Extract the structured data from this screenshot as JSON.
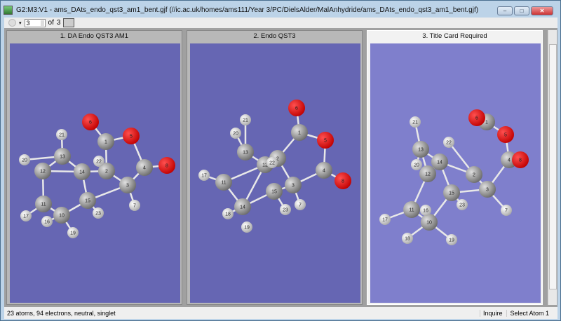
{
  "window": {
    "title": "G2:M3:V1 - ams_DAts_endo_qst3_am1_bent.gjf (//ic.ac.uk/homes/ams111/Year 3/PC/DielsAlder/MalAnhydride/ams_DAts_endo_qst3_am1_bent.gjf)",
    "minimize": "–",
    "maximize": "□",
    "close": "✕"
  },
  "toolbar": {
    "frame_value": "3",
    "of_label": "of",
    "total": "3"
  },
  "panels": [
    {
      "title": "1.  DA Endo QST3 AM1",
      "bg": "#6666b3",
      "atoms": [
        {
          "label": "1",
          "el": "C"
        },
        {
          "label": "2",
          "el": "C"
        },
        {
          "label": "3",
          "el": "C"
        },
        {
          "label": "4",
          "el": "C"
        },
        {
          "label": "5",
          "el": "O"
        },
        {
          "label": "6",
          "el": "O"
        },
        {
          "label": "7",
          "el": "H"
        },
        {
          "label": "8",
          "el": "O"
        },
        {
          "label": "10",
          "el": "C"
        },
        {
          "label": "11",
          "el": "C"
        },
        {
          "label": "12",
          "el": "C"
        },
        {
          "label": "13",
          "el": "C"
        },
        {
          "label": "14",
          "el": "C"
        },
        {
          "label": "15",
          "el": "C"
        },
        {
          "label": "16",
          "el": "H"
        },
        {
          "label": "17",
          "el": "H"
        },
        {
          "label": "19",
          "el": "H"
        },
        {
          "label": "20",
          "el": "H"
        },
        {
          "label": "21",
          "el": "H"
        },
        {
          "label": "22",
          "el": "H"
        },
        {
          "label": "23",
          "el": "H"
        }
      ]
    },
    {
      "title": "2.  Endo QST3",
      "bg": "#6666b3",
      "atoms": [
        {
          "label": "1",
          "el": "C"
        },
        {
          "label": "2",
          "el": "C"
        },
        {
          "label": "3",
          "el": "C"
        },
        {
          "label": "4",
          "el": "C"
        },
        {
          "label": "5",
          "el": "O"
        },
        {
          "label": "6",
          "el": "O"
        },
        {
          "label": "7",
          "el": "H"
        },
        {
          "label": "8",
          "el": "O"
        },
        {
          "label": "11",
          "el": "C"
        },
        {
          "label": "12",
          "el": "C"
        },
        {
          "label": "13",
          "el": "C"
        },
        {
          "label": "14",
          "el": "C"
        },
        {
          "label": "15",
          "el": "C"
        },
        {
          "label": "17",
          "el": "H"
        },
        {
          "label": "18",
          "el": "H"
        },
        {
          "label": "19",
          "el": "H"
        },
        {
          "label": "20",
          "el": "H"
        },
        {
          "label": "21",
          "el": "H"
        },
        {
          "label": "22",
          "el": "H"
        },
        {
          "label": "23",
          "el": "H"
        }
      ]
    },
    {
      "title": "3.  Title Card Required",
      "bg": "#7f7fcc",
      "atoms": [
        {
          "label": "1",
          "el": "C"
        },
        {
          "label": "2",
          "el": "C"
        },
        {
          "label": "3",
          "el": "C"
        },
        {
          "label": "4",
          "el": "C"
        },
        {
          "label": "5",
          "el": "O"
        },
        {
          "label": "6",
          "el": "O"
        },
        {
          "label": "7",
          "el": "H"
        },
        {
          "label": "8",
          "el": "O"
        },
        {
          "label": "10",
          "el": "C"
        },
        {
          "label": "11",
          "el": "C"
        },
        {
          "label": "12",
          "el": "C"
        },
        {
          "label": "13",
          "el": "C"
        },
        {
          "label": "14",
          "el": "C"
        },
        {
          "label": "15",
          "el": "C"
        },
        {
          "label": "16",
          "el": "H"
        },
        {
          "label": "17",
          "el": "H"
        },
        {
          "label": "18",
          "el": "H"
        },
        {
          "label": "19",
          "el": "H"
        },
        {
          "label": "20",
          "el": "H"
        },
        {
          "label": "21",
          "el": "H"
        },
        {
          "label": "22",
          "el": "H"
        },
        {
          "label": "23",
          "el": "H"
        }
      ]
    }
  ],
  "status": {
    "info": "23 atoms, 94 electrons, neutral, singlet",
    "mode": "Inquire",
    "action": "Select Atom 1"
  }
}
